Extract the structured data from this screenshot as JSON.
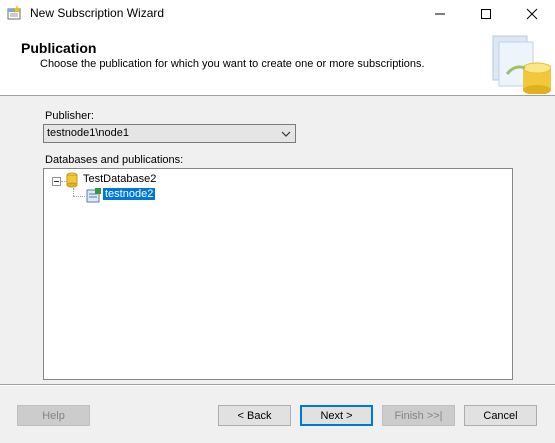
{
  "window": {
    "title": "New Subscription Wizard"
  },
  "header": {
    "title": "Publication",
    "subtitle": "Choose the publication for which you want to create one or more subscriptions."
  },
  "publisher": {
    "label": "Publisher:",
    "value": "testnode1\\node1"
  },
  "tree": {
    "label": "Databases and publications:",
    "database": "TestDatabase2",
    "publication": "testnode2"
  },
  "buttons": {
    "help": "Help",
    "back": "< Back",
    "next": "Next >",
    "finish": "Finish >>|",
    "cancel": "Cancel"
  }
}
